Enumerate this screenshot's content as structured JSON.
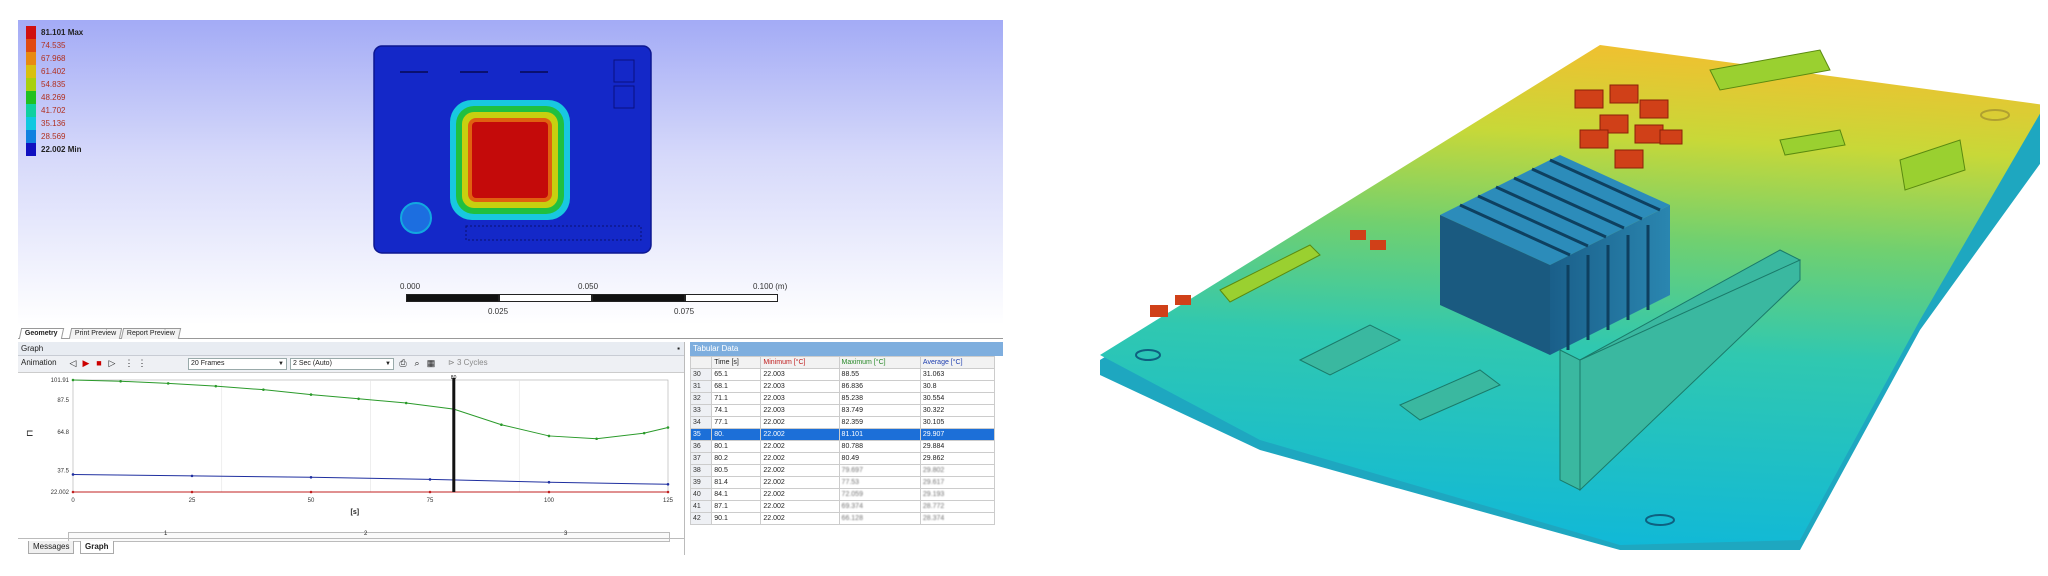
{
  "legend": [
    {
      "label": "81.101 Max",
      "color": "#d01010",
      "bold": true
    },
    {
      "label": "74.535",
      "color": "#e04a10"
    },
    {
      "label": "67.968",
      "color": "#e88a10"
    },
    {
      "label": "61.402",
      "color": "#d8c010"
    },
    {
      "label": "54.835",
      "color": "#a8d010"
    },
    {
      "label": "48.269",
      "color": "#20c020"
    },
    {
      "label": "41.702",
      "color": "#10d0a0"
    },
    {
      "label": "35.136",
      "color": "#10c8e0"
    },
    {
      "label": "28.569",
      "color": "#1080e0"
    },
    {
      "label": "22.002 Min",
      "color": "#1010c0",
      "bold": true
    }
  ],
  "scale": {
    "t0": "0.000",
    "t1": "0.050",
    "t2": "0.100 (m)",
    "b1": "0.025",
    "b2": "0.075"
  },
  "tabs": [
    "Geometry",
    "Print Preview",
    "Report Preview"
  ],
  "graph": {
    "title": "Graph",
    "pin": "̄",
    "animation_label": "Animation",
    "frames": "20 Frames",
    "duration": "2 Sec (Auto)",
    "cycles": "3 Cycles",
    "y_ticks": [
      "101.91",
      "87.5",
      "64.8",
      "37.5",
      "22.002"
    ],
    "x_ticks": [
      "0",
      "25",
      "50",
      "75",
      "100",
      "125"
    ],
    "x_label": "[s]",
    "marker_label": "80",
    "steps": [
      "1",
      "2",
      "3"
    ]
  },
  "bottom_tabs": [
    "Messages",
    "Graph"
  ],
  "table": {
    "title": "Tabular Data",
    "headers": [
      "",
      "Time [s]",
      "Minimum [°C]",
      "Maximum [°C]",
      "Average [°C]"
    ],
    "rows": [
      [
        "30",
        "65.1",
        "22.003",
        "88.55",
        "31.063"
      ],
      [
        "31",
        "68.1",
        "22.003",
        "86.836",
        "30.8"
      ],
      [
        "32",
        "71.1",
        "22.003",
        "85.238",
        "30.554"
      ],
      [
        "33",
        "74.1",
        "22.003",
        "83.749",
        "30.322"
      ],
      [
        "34",
        "77.1",
        "22.002",
        "82.359",
        "30.105"
      ],
      [
        "35",
        "80.",
        "22.002",
        "81.101",
        "29.907"
      ],
      [
        "36",
        "80.1",
        "22.002",
        "80.788",
        "29.884"
      ],
      [
        "37",
        "80.2",
        "22.002",
        "80.49",
        "29.862"
      ],
      [
        "38",
        "80.5",
        "22.002",
        "79.697",
        "29.802"
      ],
      [
        "39",
        "81.4",
        "22.002",
        "77.53",
        "29.617"
      ],
      [
        "40",
        "84.1",
        "22.002",
        "72.059",
        "29.193"
      ],
      [
        "41",
        "87.1",
        "22.002",
        "69.374",
        "28.772"
      ],
      [
        "42",
        "90.1",
        "22.002",
        "66.128",
        "28.374"
      ]
    ],
    "selected": 5
  },
  "chart_data": {
    "type": "line",
    "xlabel": "[s]",
    "ylabel": "",
    "xlim": [
      0,
      125
    ],
    "ylim": [
      22.002,
      101.91
    ],
    "series": [
      {
        "name": "Maximum [°C]",
        "color": "#2a9a2a",
        "x": [
          0,
          10,
          20,
          30,
          40,
          50,
          60,
          70,
          80,
          90,
          100,
          110,
          120,
          125
        ],
        "y": [
          101.91,
          101.0,
          99.5,
          97.5,
          95.0,
          91.5,
          88.5,
          85.5,
          81.1,
          70.0,
          62.0,
          60.0,
          64.0,
          68.0
        ]
      },
      {
        "name": "Average [°C]",
        "color": "#2030a0",
        "x": [
          0,
          25,
          50,
          75,
          100,
          125
        ],
        "y": [
          34.5,
          33.5,
          32.5,
          31.0,
          29.0,
          27.5
        ]
      },
      {
        "name": "Minimum [°C]",
        "color": "#c02020",
        "x": [
          0,
          25,
          50,
          75,
          100,
          125
        ],
        "y": [
          22.002,
          22.002,
          22.002,
          22.002,
          22.002,
          22.002
        ]
      }
    ],
    "marker_x": 80
  },
  "colors": {
    "viewport_top": "#a3abf6",
    "board_blue": "#1020c8",
    "hot": "#c40a0a",
    "selection": "#1c6fd8"
  }
}
